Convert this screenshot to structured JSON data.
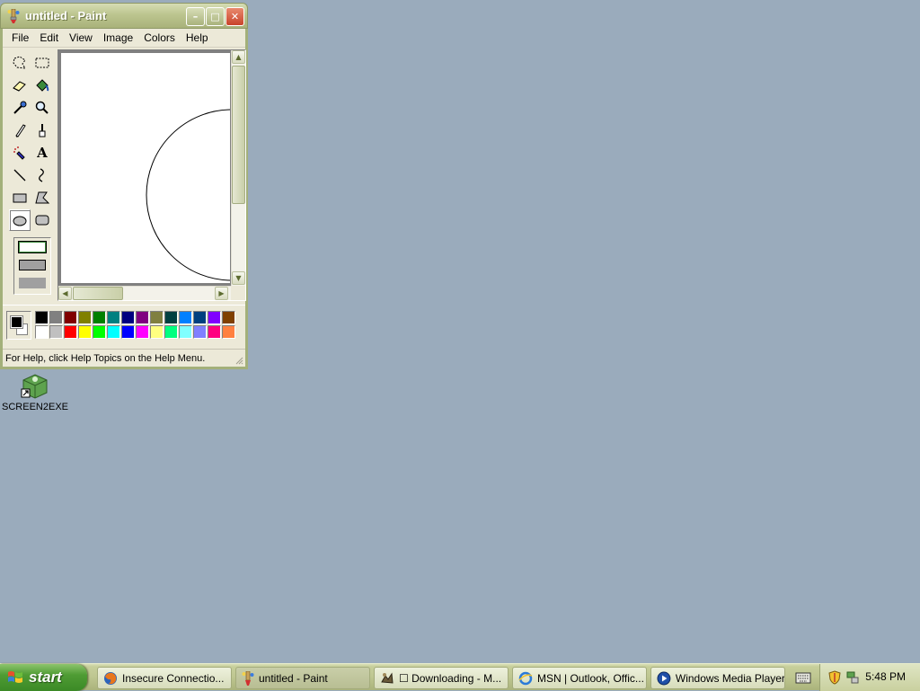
{
  "window": {
    "title": "untitled - Paint",
    "min_glyph": "–",
    "max_glyph": "□",
    "close_glyph": "✕"
  },
  "menu": [
    "File",
    "Edit",
    "View",
    "Image",
    "Colors",
    "Help"
  ],
  "tools": [
    "free-form-select",
    "select",
    "eraser",
    "fill-with-color",
    "pick-color",
    "magnifier",
    "pencil",
    "brush",
    "airbrush",
    "text",
    "line",
    "curve",
    "rectangle",
    "polygon",
    "ellipse",
    "rounded-rectangle"
  ],
  "selected_tool": "ellipse",
  "text_tool_glyph": "A",
  "palette": {
    "top": [
      "#000000",
      "#808080",
      "#800000",
      "#808000",
      "#008000",
      "#008080",
      "#000080",
      "#800080",
      "#808040",
      "#004040",
      "#0080ff",
      "#004080",
      "#8000ff",
      "#804000"
    ],
    "bottom": [
      "#ffffff",
      "#c0c0c0",
      "#ff0000",
      "#ffff00",
      "#00ff00",
      "#00ffff",
      "#0000ff",
      "#ff00ff",
      "#ffff80",
      "#00ff80",
      "#80ffff",
      "#8080ff",
      "#ff0080",
      "#ff8040"
    ]
  },
  "status": "For Help, click Help Topics on the Help Menu.",
  "desktop": {
    "icon_label": "SCREEN2EXE"
  },
  "taskbar": {
    "start_label": "start",
    "tasks": [
      {
        "label": "Insecure Connectio...",
        "icon": "firefox-icon"
      },
      {
        "label": "untitled - Paint",
        "icon": "paint-icon"
      },
      {
        "label": "☐ Downloading - M...",
        "icon": "download-icon"
      },
      {
        "label": "MSN | Outlook, Offic...",
        "icon": "ie-icon"
      },
      {
        "label": "Windows Media Player",
        "icon": "media-player-icon"
      }
    ],
    "clock": "5:48 PM"
  }
}
